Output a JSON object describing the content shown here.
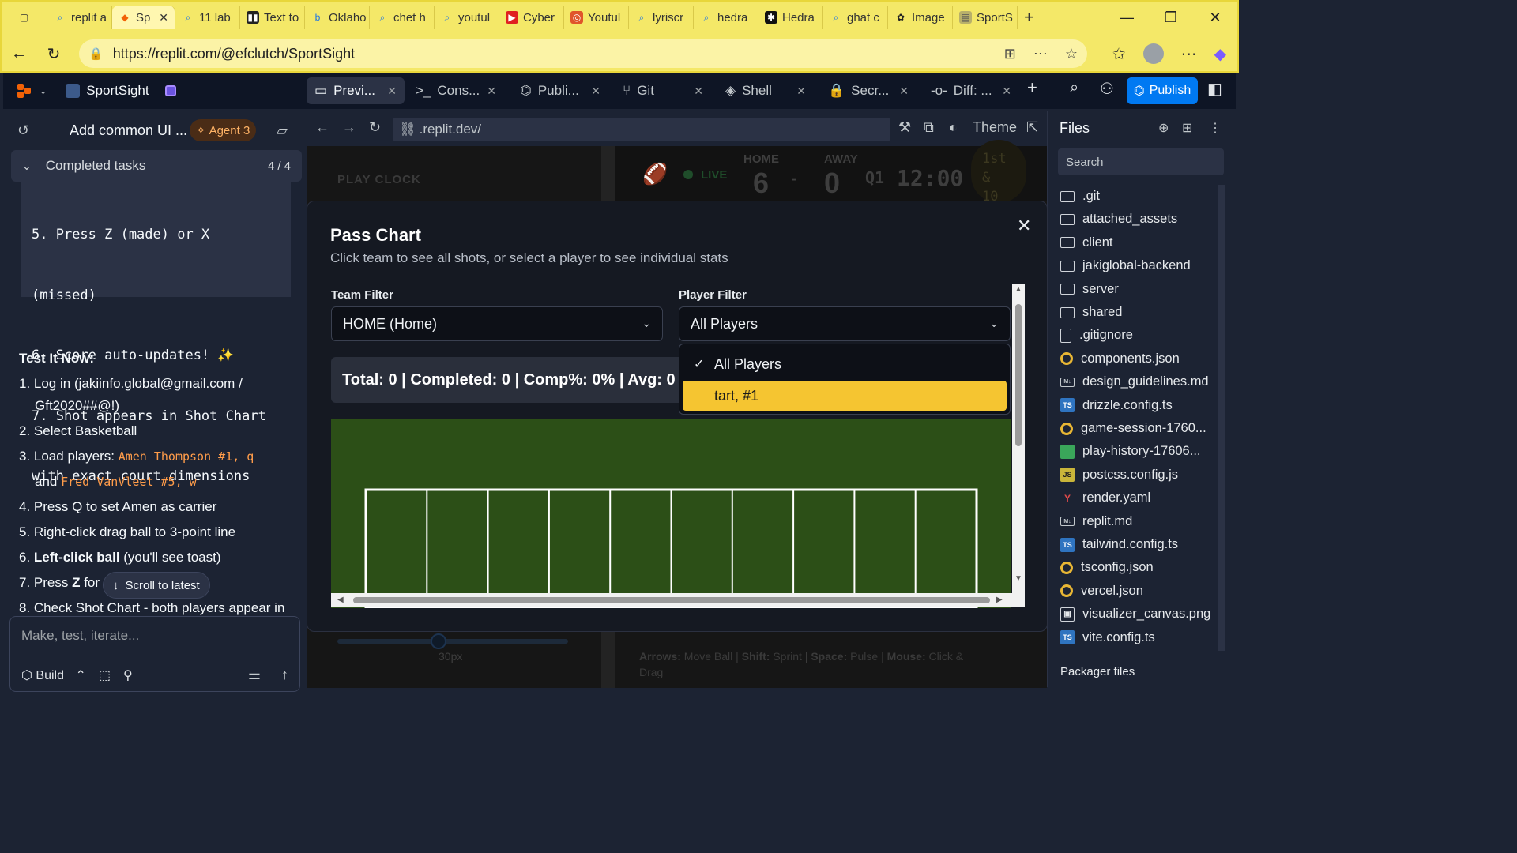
{
  "browser": {
    "tabs": [
      {
        "label": "replit a",
        "icon": "search-icon"
      },
      {
        "label": "Sp",
        "icon": "replit-icon",
        "active": true
      },
      {
        "label": "11 lab",
        "icon": "search-icon"
      },
      {
        "label": "Text to",
        "icon": "text-icon"
      },
      {
        "label": "Oklaho",
        "icon": "bing-icon"
      },
      {
        "label": "chet h",
        "icon": "search-icon"
      },
      {
        "label": "youtul",
        "icon": "search-icon"
      },
      {
        "label": "Cyber",
        "icon": "youtube-icon"
      },
      {
        "label": "Youtul",
        "icon": "ubuntu-icon"
      },
      {
        "label": "lyriscr",
        "icon": "search-icon"
      },
      {
        "label": "hedra",
        "icon": "search-icon"
      },
      {
        "label": "Hedra",
        "icon": "hedra-icon"
      },
      {
        "label": "ghat c",
        "icon": "search-icon"
      },
      {
        "label": "Image",
        "icon": "chatgpt-icon"
      },
      {
        "label": "SportS",
        "icon": "page-icon"
      }
    ],
    "url": "https://replit.com/@efclutch/SportSight",
    "colors": {
      "chrome": "#f4e868"
    }
  },
  "replit": {
    "project_name": "SportSight",
    "tabs": [
      {
        "label": "Previ...",
        "icon": "monitor-icon"
      },
      {
        "label": "Cons...",
        "icon": "terminal-icon"
      },
      {
        "label": "Publi...",
        "icon": "publish-icon"
      },
      {
        "label": "Git",
        "icon": "git-icon"
      },
      {
        "label": "Shell",
        "icon": "shell-icon"
      },
      {
        "label": "Secr...",
        "icon": "lock-icon"
      },
      {
        "label": "Diff: ...",
        "icon": "diff-icon"
      }
    ],
    "publish_label": "Publish"
  },
  "agent": {
    "title": "Add common UI ...",
    "badge": "Agent 3",
    "completed_label": "Completed tasks",
    "completed_count": "4 / 4",
    "code_lines": [
      "5. Press Z (made) or X",
      "(missed)",
      "6. Score auto-updates! ✨",
      "7. Shot appears in Shot Chart",
      "with exact court dimensions"
    ],
    "test_heading": "Test It Now:",
    "step1_a": "1. Log in (",
    "step1_link": "jakiinfo.global@gmail.com",
    "step1_b": " /",
    "step1_c": "Gft2020##@!)",
    "step2": "2. Select Basketball",
    "step3_a": "3. Load players: ",
    "step3_code1": "Amen Thompson #1, q",
    "step3_b": "and ",
    "step3_code2": "Fred VanVleet #5, w",
    "step4": "4. Press Q to set Amen as carrier",
    "step5": "5. Right-click drag ball to 3-point line",
    "step6_a": "6. ",
    "step6_bold": "Left-click ball",
    "step6_b": " (you'll see toast)",
    "step7_a": "7. Press ",
    "step7_bold": "Z",
    "step7_b": " for",
    "step8": "8. Check Shot Chart - both players appear in",
    "scroll_latest": "Scroll to latest",
    "input_placeholder": "Make, test, iterate...",
    "build_label": "Build"
  },
  "preview": {
    "url": ".replit.dev/",
    "theme_label": "Theme",
    "play_clock": "PLAY CLOCK",
    "live": "LIVE",
    "home_label": "HOME",
    "away_label": "AWAY",
    "home_score": "6",
    "away_score": "0",
    "quarter": "Q1",
    "clock": "12:00",
    "down_1": "1st",
    "down_2": "&",
    "down_3": "10",
    "slider_label": "30px",
    "controls_1": "Arrows:",
    "controls_1v": " Move Ball",
    "controls_2": "Shift:",
    "controls_2v": " Sprint",
    "controls_3": "Space:",
    "controls_3v": " Pulse",
    "controls_4": "Mouse:",
    "controls_4v": " Click &",
    "controls_5": "Drag"
  },
  "modal": {
    "title": "Pass Chart",
    "subtitle": "Click team to see all shots, or select a player to see individual stats",
    "team_filter_label": "Team Filter",
    "team_filter_value": "HOME (Home)",
    "player_filter_label": "Player Filter",
    "player_filter_value": "All Players",
    "stats": "Total: 0 | Completed: 0 | Comp%: 0% | Avg: 0",
    "dropdown_options": [
      "All Players",
      "tart, #1"
    ],
    "selected_option": "tart, #1",
    "colors": {
      "field": "#2c4f17",
      "highlight": "#f5c531"
    }
  },
  "files": {
    "title": "Files",
    "search_placeholder": "Search",
    "items": [
      {
        "name": ".git",
        "type": "folder"
      },
      {
        "name": "attached_assets",
        "type": "folder"
      },
      {
        "name": "client",
        "type": "folder"
      },
      {
        "name": "jakiglobal-backend",
        "type": "folder"
      },
      {
        "name": "server",
        "type": "folder"
      },
      {
        "name": "shared",
        "type": "folder"
      },
      {
        "name": ".gitignore",
        "type": "doc"
      },
      {
        "name": "components.json",
        "type": "json"
      },
      {
        "name": "design_guidelines.md",
        "type": "md"
      },
      {
        "name": "drizzle.config.ts",
        "type": "ts"
      },
      {
        "name": "game-session-1760...",
        "type": "json"
      },
      {
        "name": "play-history-17606...",
        "type": "sheet"
      },
      {
        "name": "postcss.config.js",
        "type": "js"
      },
      {
        "name": "render.yaml",
        "type": "yml"
      },
      {
        "name": "replit.md",
        "type": "md"
      },
      {
        "name": "tailwind.config.ts",
        "type": "ts"
      },
      {
        "name": "tsconfig.json",
        "type": "json"
      },
      {
        "name": "vercel.json",
        "type": "json"
      },
      {
        "name": "visualizer_canvas.png",
        "type": "img"
      },
      {
        "name": "vite.config.ts",
        "type": "ts"
      }
    ],
    "packager": "Packager files"
  }
}
